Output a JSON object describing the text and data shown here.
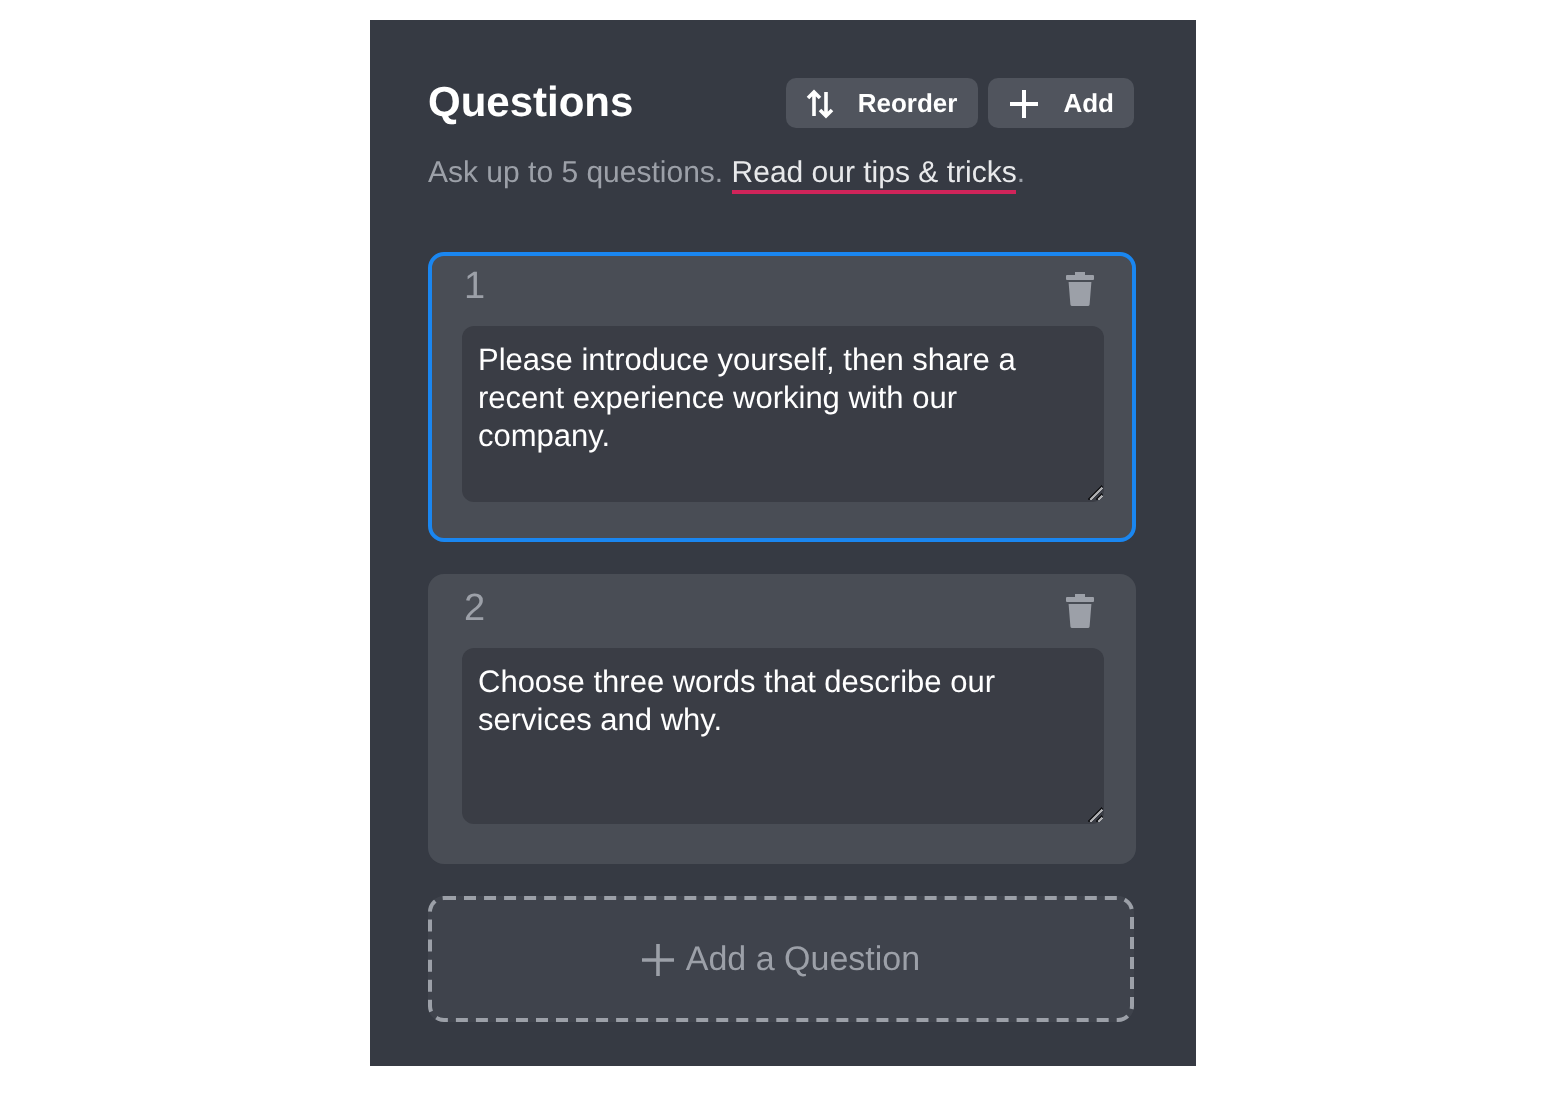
{
  "header": {
    "title": "Questions",
    "buttons": [
      {
        "kind": "reorder",
        "label": "Reorder"
      },
      {
        "kind": "add",
        "label": "Add"
      }
    ]
  },
  "subtitle": {
    "text": "Ask up to 5 questions. ",
    "link": "Read our tips & tricks",
    "after": "."
  },
  "questions": [
    {
      "number": "1",
      "text": "Please introduce yourself, then share a recent experience working with our company.",
      "selected": true
    },
    {
      "number": "2",
      "text": "Choose three words that describe our services and why.",
      "selected": false
    }
  ],
  "add_question": {
    "label": "Add a Question"
  }
}
